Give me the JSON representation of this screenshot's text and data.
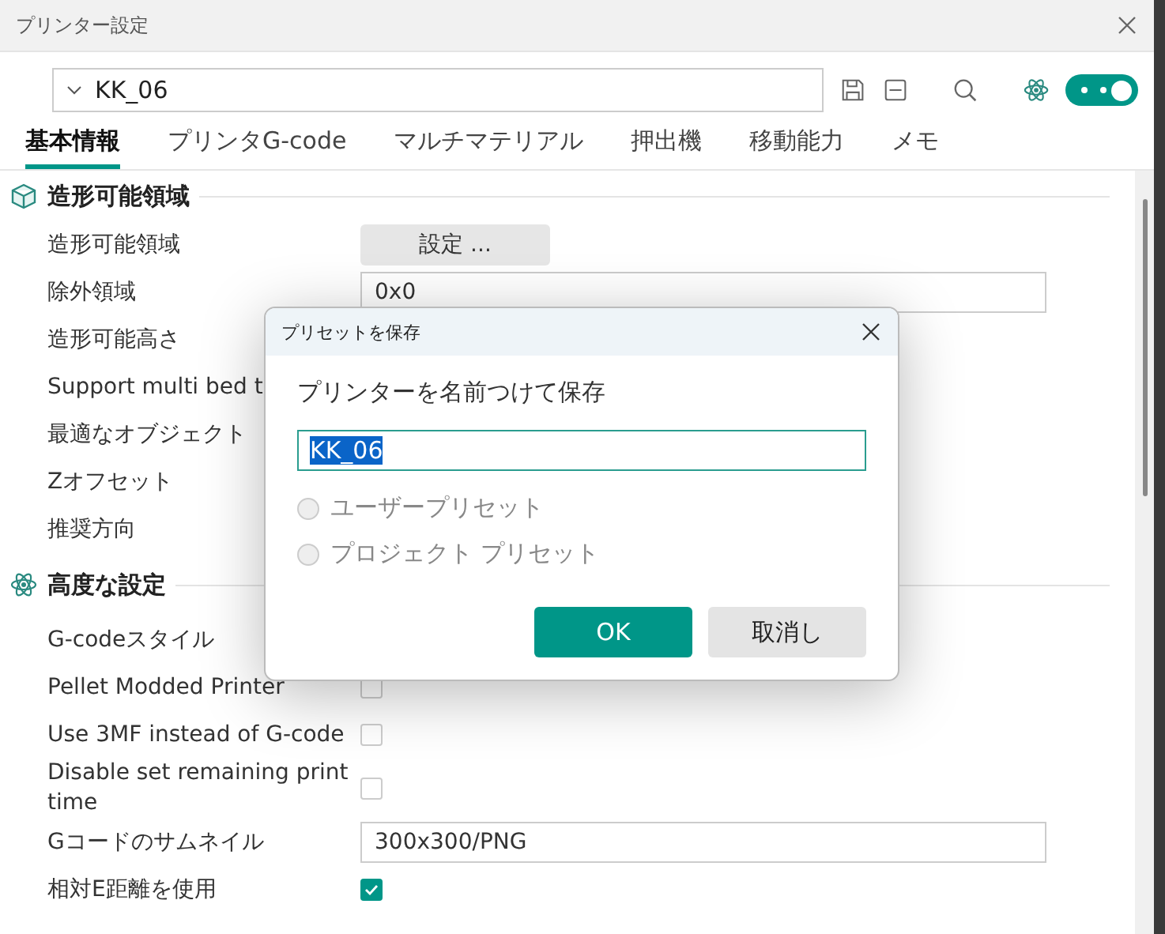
{
  "window": {
    "title": "プリンター設定"
  },
  "toolbar": {
    "preset": "KK_06",
    "toggle": {
      "on": true
    }
  },
  "tabs": [
    {
      "label": "基本情報",
      "selected": true
    },
    {
      "label": "プリンタG-code",
      "selected": false
    },
    {
      "label": "マルチマテリアル",
      "selected": false
    },
    {
      "label": "押出機",
      "selected": false
    },
    {
      "label": "移動能力",
      "selected": false
    },
    {
      "label": "メモ",
      "selected": false
    }
  ],
  "sections": [
    {
      "title": "造形可能領域",
      "kind": "cube",
      "rows": [
        {
          "label": "造形可能領域",
          "kind": "button",
          "value": "設定 ..."
        },
        {
          "label": "除外領域",
          "kind": "field",
          "value": "0x0"
        },
        {
          "label": "造形可能高さ"
        },
        {
          "label": "Support multi bed t"
        },
        {
          "label": "最適なオブジェクト"
        },
        {
          "label": "Zオフセット"
        },
        {
          "label": "推奨方向"
        }
      ]
    },
    {
      "title": "高度な設定",
      "kind": "atom",
      "rows": [
        {
          "label": "G-codeスタイル"
        },
        {
          "label": "Pellet Modded Printer",
          "kind": "checkbox",
          "checked": false
        },
        {
          "label": "Use 3MF instead of G-code",
          "kind": "checkbox",
          "checked": false
        },
        {
          "label": "Disable set remaining print time",
          "kind": "checkbox",
          "checked": false
        },
        {
          "label": "Gコードのサムネイル",
          "kind": "field",
          "value": "300x300/PNG"
        },
        {
          "label": "相対E距離を使用",
          "kind": "checkbox",
          "checked": true
        }
      ]
    }
  ],
  "dialog": {
    "title": "プリセットを保存",
    "prompt": "プリンターを名前つけて保存",
    "name": "KK_06",
    "options": [
      {
        "label": "ユーザープリセット",
        "selected": false,
        "disabled": true
      },
      {
        "label": "プロジェクト プリセット",
        "selected": false,
        "disabled": true
      }
    ],
    "buttons": [
      {
        "label": "OK",
        "kind": "primary"
      },
      {
        "label": "取消し",
        "kind": "secondary"
      }
    ]
  }
}
